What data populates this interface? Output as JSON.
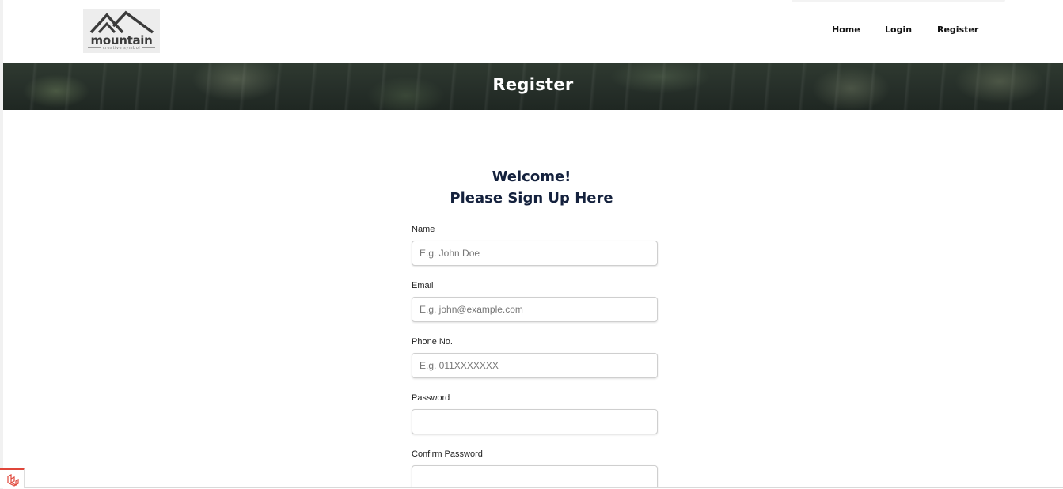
{
  "header": {
    "logo": {
      "word": "mountain",
      "tagline": "creative symbol"
    },
    "nav": {
      "home": "Home",
      "login": "Login",
      "register": "Register"
    }
  },
  "banner": {
    "title": "Register"
  },
  "form": {
    "welcome_line1": "Welcome!",
    "welcome_line2": "Please Sign Up Here",
    "fields": {
      "name": {
        "label": "Name",
        "placeholder": "E.g. John Doe",
        "value": ""
      },
      "email": {
        "label": "Email",
        "placeholder": "E.g. john@example.com",
        "value": ""
      },
      "phone": {
        "label": "Phone No.",
        "placeholder": "E.g. 011XXXXXXX",
        "value": ""
      },
      "password": {
        "label": "Password",
        "placeholder": "",
        "value": ""
      },
      "confirm_password": {
        "label": "Confirm Password",
        "placeholder": "",
        "value": ""
      }
    }
  },
  "icons": {
    "logo": "mountain-logo-icon",
    "debug": "laravel-icon"
  },
  "colors": {
    "heading": "#14213d",
    "banner_text": "#ffffff",
    "debug_accent": "#e0463a"
  }
}
